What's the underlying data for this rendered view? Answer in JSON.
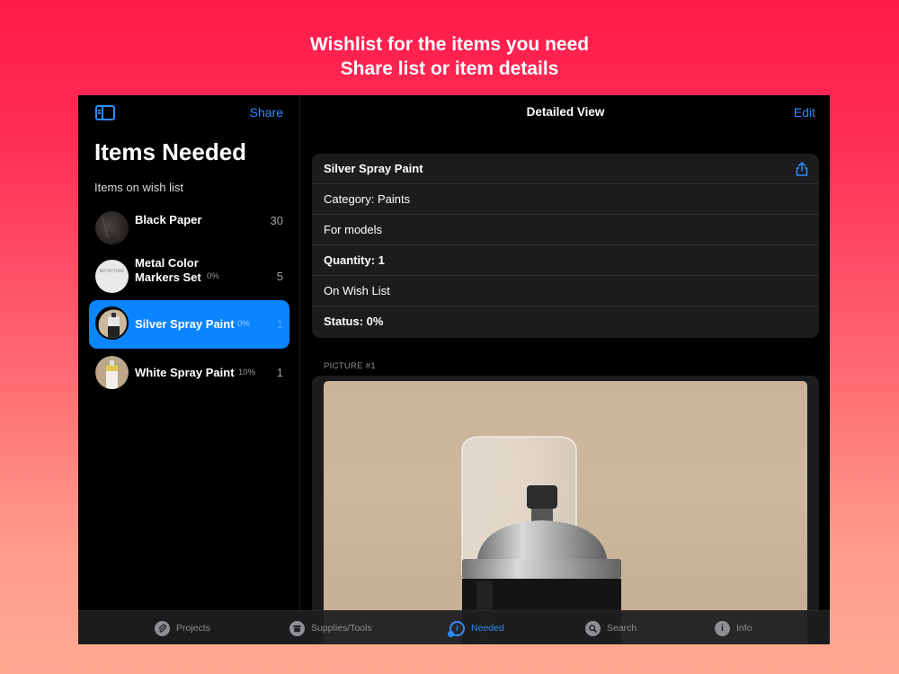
{
  "promo": {
    "line1": "Wishlist for the items you need",
    "line2": "Share list or item details"
  },
  "sidebar": {
    "share_label": "Share",
    "title": "Items Needed",
    "section_label": "Items on wish list",
    "items": [
      {
        "name": "Black Paper",
        "percent": "",
        "count": "30",
        "selected": false
      },
      {
        "name": "Metal Color Markers Set",
        "name_line1": "Metal Color",
        "name_line2": "Markers Set",
        "percent": "0%",
        "count": "5",
        "selected": false,
        "thumb_text": "NO PICTURE"
      },
      {
        "name": "Silver Spray Paint",
        "percent": "0%",
        "count": "1",
        "selected": true
      },
      {
        "name": "White Spray Paint",
        "percent": "10%",
        "count": "1",
        "selected": false
      }
    ]
  },
  "detail": {
    "nav_title": "Detailed View",
    "edit_label": "Edit",
    "rows": [
      {
        "text": "Silver Spray Paint",
        "bold": true
      },
      {
        "text": "Category: Paints",
        "bold": false
      },
      {
        "text": "For models",
        "bold": false
      },
      {
        "text": "Quantity: 1",
        "bold": true
      },
      {
        "text": "On Wish List",
        "bold": false
      },
      {
        "text": "Status: 0%",
        "bold": true
      }
    ],
    "picture_label": "PICTURE #1"
  },
  "tabs": [
    {
      "label": "Projects",
      "icon": "paperclip-icon",
      "active": false
    },
    {
      "label": "Supplies/Tools",
      "icon": "archive-box-icon",
      "active": false
    },
    {
      "label": "Needed",
      "icon": "needed-list-icon",
      "active": true
    },
    {
      "label": "Search",
      "icon": "magnifier-icon",
      "active": false
    },
    {
      "label": "Info",
      "icon": "info-icon",
      "active": false
    }
  ],
  "colors": {
    "accent": "#0a84ff",
    "link": "#2d8cff",
    "background_top": "#ff1a4a",
    "background_bottom": "#ffab92"
  }
}
